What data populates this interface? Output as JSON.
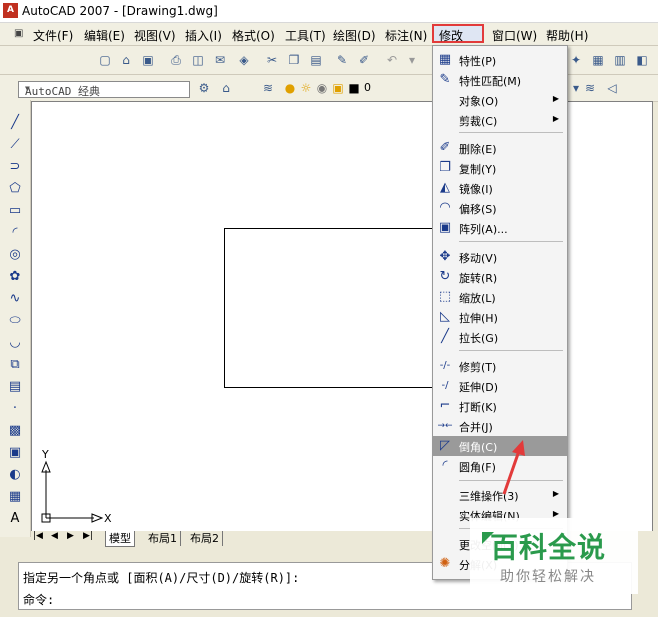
{
  "window": {
    "title": "AutoCAD 2007 - [Drawing1.dwg]",
    "app_icon_label": "A"
  },
  "menubar": {
    "items": [
      "文件(F)",
      "编辑(E)",
      "视图(V)",
      "插入(I)",
      "格式(O)",
      "工具(T)",
      "绘图(D)",
      "标注(N)",
      "修改(M)",
      "窗口(W)",
      "帮助(H)"
    ],
    "active": "修改(M)"
  },
  "toolbar": {
    "workspace_combo": "AutoCAD 经典",
    "layer_value": "0"
  },
  "dropdown": {
    "items": [
      {
        "label": "特性(P)",
        "icon": "properties-icon",
        "glyph": "▦"
      },
      {
        "label": "特性匹配(M)",
        "icon": "match-properties-icon",
        "glyph": "✎"
      },
      {
        "label": "对象(O)",
        "icon": "",
        "glyph": "",
        "submenu": true
      },
      {
        "label": "剪裁(C)",
        "icon": "",
        "glyph": "",
        "submenu": true
      },
      {
        "label": "删除(E)",
        "icon": "erase-icon",
        "glyph": "✐"
      },
      {
        "label": "复制(Y)",
        "icon": "copy-icon",
        "glyph": "❐"
      },
      {
        "label": "镜像(I)",
        "icon": "mirror-icon",
        "glyph": "◭"
      },
      {
        "label": "偏移(S)",
        "icon": "offset-icon",
        "glyph": "◠"
      },
      {
        "label": "阵列(A)...",
        "icon": "array-icon",
        "glyph": "▣"
      },
      {
        "label": "移动(V)",
        "icon": "move-icon",
        "glyph": "✥"
      },
      {
        "label": "旋转(R)",
        "icon": "rotate-icon",
        "glyph": "↻"
      },
      {
        "label": "缩放(L)",
        "icon": "scale-icon",
        "glyph": "⬚"
      },
      {
        "label": "拉伸(H)",
        "icon": "stretch-icon",
        "glyph": "◺"
      },
      {
        "label": "拉长(G)",
        "icon": "lengthen-icon",
        "glyph": "╱"
      },
      {
        "label": "修剪(T)",
        "icon": "trim-icon",
        "glyph": "-/-"
      },
      {
        "label": "延伸(D)",
        "icon": "extend-icon",
        "glyph": "-/"
      },
      {
        "label": "打断(K)",
        "icon": "break-icon",
        "glyph": "⌐"
      },
      {
        "label": "合并(J)",
        "icon": "join-icon",
        "glyph": "→←"
      },
      {
        "label": "倒角(C)",
        "icon": "chamfer-icon",
        "glyph": "◸",
        "highlighted": true
      },
      {
        "label": "圆角(F)",
        "icon": "fillet-icon",
        "glyph": "◜"
      },
      {
        "label": "三维操作(3)",
        "icon": "",
        "glyph": "",
        "submenu": true
      },
      {
        "label": "实体编辑(N)",
        "icon": "",
        "glyph": "",
        "submenu": true
      },
      {
        "label": "更改空间(S)",
        "icon": "",
        "glyph": ""
      },
      {
        "label": "分解(X)",
        "icon": "explode-icon",
        "glyph": "✺"
      }
    ]
  },
  "layout_tabs": [
    "模型",
    "布局1",
    "布局2"
  ],
  "command": {
    "line1": "指定另一个角点或 [面积(A)/尺寸(D)/旋转(R)]:",
    "prompt": "命令:"
  },
  "ucs": {
    "x_label": "X",
    "y_label": "Y"
  },
  "watermark": {
    "title": "百科全说",
    "subtitle": "助你轻松解决"
  },
  "colors": {
    "highlight_border": "#e23a3a",
    "menu_highlight": "#9a9a9a",
    "watermark_green": "#2a9a4c",
    "arrow_red": "#e23a3a"
  }
}
